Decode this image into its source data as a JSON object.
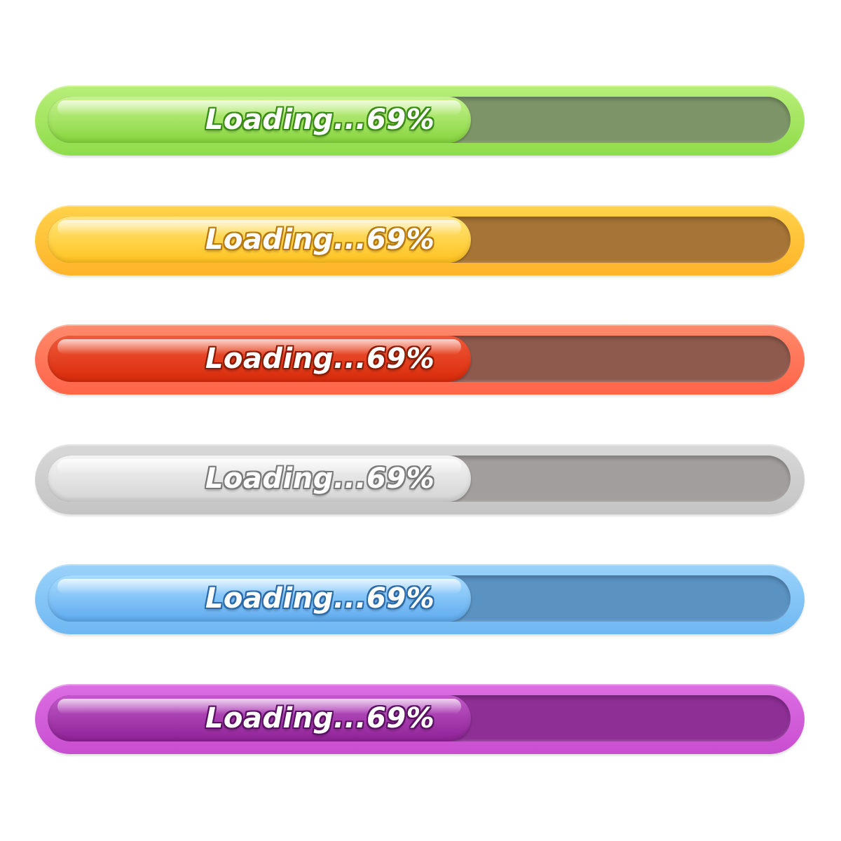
{
  "progress_bars": [
    {
      "label": "Loading...69%",
      "progress_percent": 69,
      "colors": {
        "frame": "#8fdc4a",
        "frame_light": "#b8ee78",
        "track": "#7c9468",
        "fill_top": "#c6f28e",
        "fill_bottom": "#86d53d",
        "text_stroke": "#3a8a16"
      }
    },
    {
      "label": "Loading...69%",
      "progress_percent": 69,
      "colors": {
        "frame": "#ffb429",
        "frame_light": "#ffd24a",
        "track": "#a67436",
        "fill_top": "#ffe67a",
        "fill_bottom": "#ffc21e",
        "text_stroke": "#b77a10"
      }
    },
    {
      "label": "Loading...69%",
      "progress_percent": 69,
      "colors": {
        "frame": "#ff6448",
        "frame_light": "#ff8a6c",
        "track": "#8e5a4e",
        "fill_top": "#f05a3a",
        "fill_bottom": "#d82a0a",
        "text_stroke": "#8a1a04"
      }
    },
    {
      "label": "Loading...69%",
      "progress_percent": 69,
      "colors": {
        "frame": "#c4c4c4",
        "frame_light": "#d8d8d8",
        "track": "#a39e9e",
        "fill_top": "#f4f4f4",
        "fill_bottom": "#d4d4d4",
        "text_stroke": "#7a7a7a"
      }
    },
    {
      "label": "Loading...69%",
      "progress_percent": 69,
      "colors": {
        "frame": "#6fb8f2",
        "frame_light": "#9ad2fa",
        "track": "#5a92c2",
        "fill_top": "#a8dcff",
        "fill_bottom": "#5eaaee",
        "text_stroke": "#2a6aa8"
      }
    },
    {
      "label": "Loading...69%",
      "progress_percent": 69,
      "colors": {
        "frame": "#c84ed0",
        "frame_light": "#dc6ee2",
        "track": "#8e2f96",
        "fill_top": "#c05ac8",
        "fill_bottom": "#8e2196",
        "text_stroke": "#5a1062"
      }
    }
  ]
}
